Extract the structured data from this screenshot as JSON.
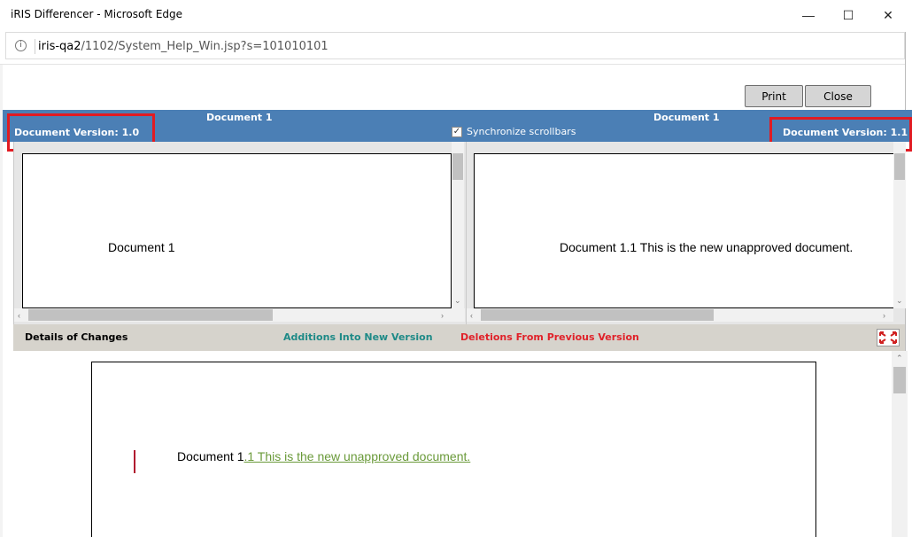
{
  "window": {
    "title": "iRIS Differencer - Microsoft Edge",
    "minimize": "—",
    "maximize": "☐",
    "close": "✕"
  },
  "address": {
    "info_icon": "i",
    "host": "iris-qa2",
    "path": "/1102/System_Help_Win.jsp?s=101010101"
  },
  "toolbar": {
    "print_label": "Print",
    "close_label": "Close"
  },
  "left_doc": {
    "title": "Document 1",
    "version": "Document Version: 1.0",
    "content": "Document 1"
  },
  "right_doc": {
    "title": "Document 1",
    "version": "Document Version: 1.1",
    "content": "Document 1.1 This is the new unapproved document."
  },
  "sync": {
    "label": "Synchronize scrollbars",
    "checked": true
  },
  "details": {
    "title": "Details of Changes",
    "additions_label": "Additions Into New Version",
    "deletions_label": "Deletions From Previous Version",
    "additions_color": "#1e8a87",
    "deletions_color": "#e0222a"
  },
  "changes": {
    "base_text": "Document 1",
    "added_text": ".1 This is the new unapproved document."
  },
  "colors": {
    "header_bg": "#4b7fb5",
    "highlight_box": "#e11b22",
    "added_text": "#6a9a3a"
  }
}
